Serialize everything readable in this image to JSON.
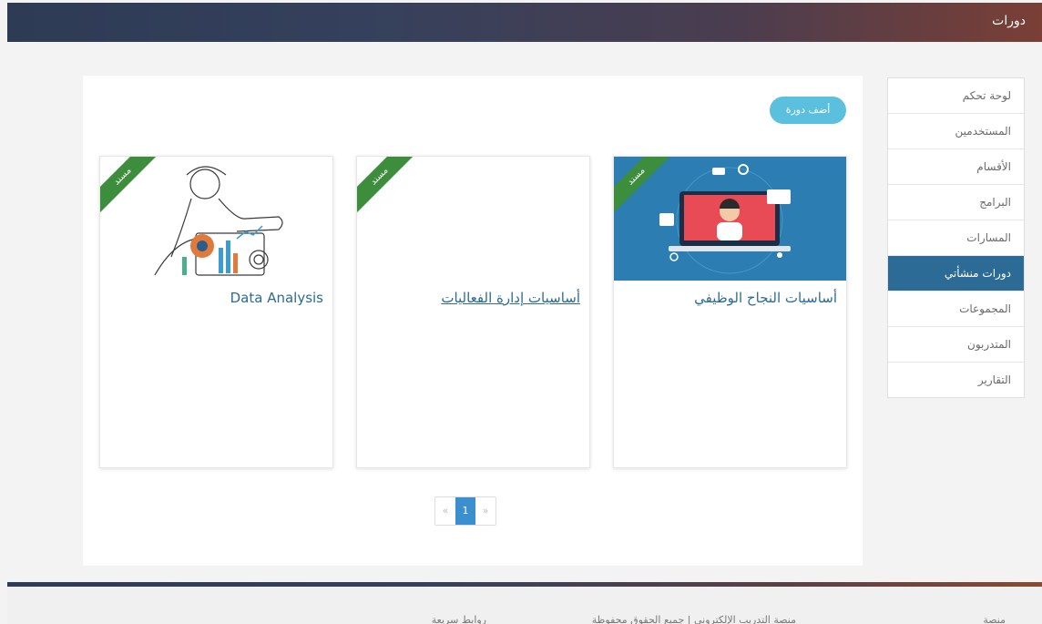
{
  "header": {
    "title": "دورات"
  },
  "sidebar": {
    "items": [
      {
        "label": "لوحة تحكم"
      },
      {
        "label": "المستخدمين"
      },
      {
        "label": "الأقسام"
      },
      {
        "label": "البرامج"
      },
      {
        "label": "المسارات"
      },
      {
        "label": "دورات منشأتي",
        "active": true
      },
      {
        "label": "المجموعات"
      },
      {
        "label": "المتدربون"
      },
      {
        "label": "التقارير"
      }
    ]
  },
  "main": {
    "add_button": "أضف دورة",
    "cards": [
      {
        "title": "أساسيات النجاح الوظيفي",
        "ribbon": "مسند",
        "thumb": "video-call-illustration"
      },
      {
        "title": "أساسيات إدارة الفعاليات",
        "ribbon": "مسند",
        "thumb": "none"
      },
      {
        "title": "Data Analysis",
        "ribbon": "مسند",
        "thumb": "data-analyst-illustration"
      }
    ],
    "pagination": {
      "prev": "«",
      "current": "1",
      "next": "»"
    }
  },
  "footer": {
    "links": [
      "منصة",
      "منصة التدريب الإلكتروني | جميع الحقوق محفوظة",
      "روابط سريعة"
    ]
  },
  "colors": {
    "accent": "#2b6b95",
    "add_button": "#5bc0de",
    "ribbon": "#3c8d3c",
    "pager_active": "#3b8fcf"
  }
}
